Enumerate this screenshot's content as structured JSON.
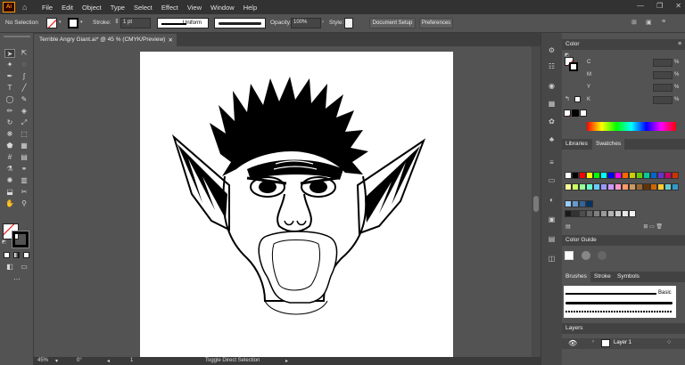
{
  "app": {
    "logo": "Ai"
  },
  "menu": [
    "File",
    "Edit",
    "Object",
    "Type",
    "Select",
    "Effect",
    "View",
    "Window",
    "Help"
  ],
  "control": {
    "selection": "No Selection",
    "stroke_label": "Stroke:",
    "stroke_value": "1 pt",
    "profile": "Uniform",
    "opacity_label": "Opacity:",
    "opacity_value": "100%",
    "style_label": "Style:",
    "doc_setup": "Document Setup",
    "preferences": "Preferences"
  },
  "document": {
    "tab_title": "Terrible Angry Giant.ai* @ 45 % (CMYK/Preview)"
  },
  "status": {
    "zoom": "45%",
    "rotation": "0°",
    "artboard": "1",
    "tool_hint": "Toggle Direct Selection"
  },
  "color_panel": {
    "title": "Color",
    "channels": [
      {
        "label": "C",
        "unit": "%"
      },
      {
        "label": "M",
        "unit": "%"
      },
      {
        "label": "Y",
        "unit": "%"
      },
      {
        "label": "K",
        "unit": "%"
      }
    ]
  },
  "swatch_panel": {
    "tabs": [
      "Libraries",
      "Swatches"
    ]
  },
  "color_guide": {
    "title": "Color Guide"
  },
  "brushes": {
    "tabs": [
      "Brushes",
      "Stroke",
      "Symbols"
    ],
    "basic_label": "Basic"
  },
  "layers": {
    "title": "Layers",
    "layer_name": "Layer 1"
  },
  "icons": {
    "home": "home-icon",
    "selection": "selection-tool-icon",
    "direct": "direct-selection-tool-icon",
    "color": "color-panel-icon"
  },
  "colors": {
    "ui_dark": "#323232",
    "ui_panel": "#535353",
    "accent": "#ff9a00",
    "swatch_row1": [
      "#ffffff",
      "#000000",
      "#ff0000",
      "#ffff00",
      "#00ff00",
      "#00ffff",
      "#0000ff",
      "#ff00ff",
      "#ff6600",
      "#cccc00",
      "#66cc00",
      "#00cc99",
      "#0066cc",
      "#6633cc",
      "#cc0066",
      "#cc3300"
    ],
    "swatch_row2": [
      "#ffff99",
      "#ccff66",
      "#99ff99",
      "#66ffcc",
      "#66ccff",
      "#9999ff",
      "#cc99ff",
      "#ff99cc",
      "#ff9966",
      "#cc9966",
      "#996633",
      "#663300",
      "#cc6600",
      "#ffcc33",
      "#66cccc",
      "#3399cc"
    ],
    "swatch_row3": [
      "#99ccff",
      "#6699cc",
      "#336699",
      "#003366"
    ],
    "swatch_row4": [
      "#1a1a1a",
      "#333333",
      "#4d4d4d",
      "#666666",
      "#808080",
      "#999999",
      "#b3b3b3",
      "#cccccc",
      "#e6e6e6",
      "#f2f2f2"
    ]
  }
}
